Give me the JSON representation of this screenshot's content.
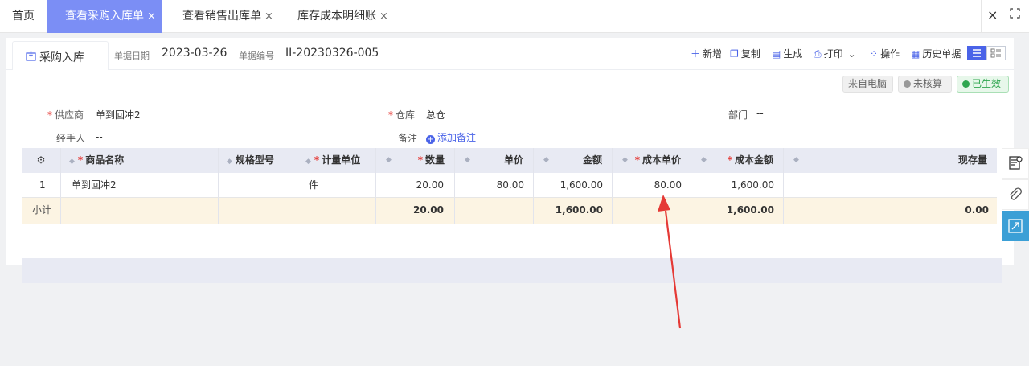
{
  "tabs": {
    "home": "首页",
    "active": "查看采购入库单",
    "tab3": "查看销售出库单",
    "tab4": "库存成本明细账",
    "close_glyph": "×"
  },
  "header": {
    "doc_type": "采购入库",
    "date_label": "单据日期",
    "date_value": "2023-03-26",
    "no_label": "单据编号",
    "no_value": "II-20230326-005"
  },
  "toolbar": {
    "new": "新增",
    "copy": "复制",
    "generate": "生成",
    "print": "打印",
    "operate": "操作",
    "history": "历史单据"
  },
  "badges": {
    "from": "来自电脑",
    "unchecked": "未核算",
    "effective": "已生效"
  },
  "form": {
    "supplier_label": "供应商",
    "supplier_value": "单到回冲2",
    "warehouse_label": "仓库",
    "warehouse_value": "总仓",
    "dept_label": "部门",
    "dept_value": "--",
    "handler_label": "经手人",
    "handler_value": "--",
    "note_label": "备注",
    "add_note": "添加备注"
  },
  "table": {
    "headers": [
      "商品名称",
      "规格型号",
      "计量单位",
      "数量",
      "单价",
      "金额",
      "成本单价",
      "成本金额",
      "现存量"
    ],
    "row": {
      "index": "1",
      "name": "单到回冲2",
      "spec": "",
      "unit": "件",
      "qty": "20.00",
      "price": "80.00",
      "amount": "1,600.00",
      "cost_price": "80.00",
      "cost_amount": "1,600.00",
      "stock": ""
    },
    "subtotal": {
      "label": "小计",
      "qty": "20.00",
      "amount": "1,600.00",
      "cost_amount": "1,600.00",
      "stock": "0.00"
    }
  },
  "colors": {
    "accent": "#4a63e8",
    "active_tab": "#7b8ef5",
    "arrow": "#e53935"
  }
}
